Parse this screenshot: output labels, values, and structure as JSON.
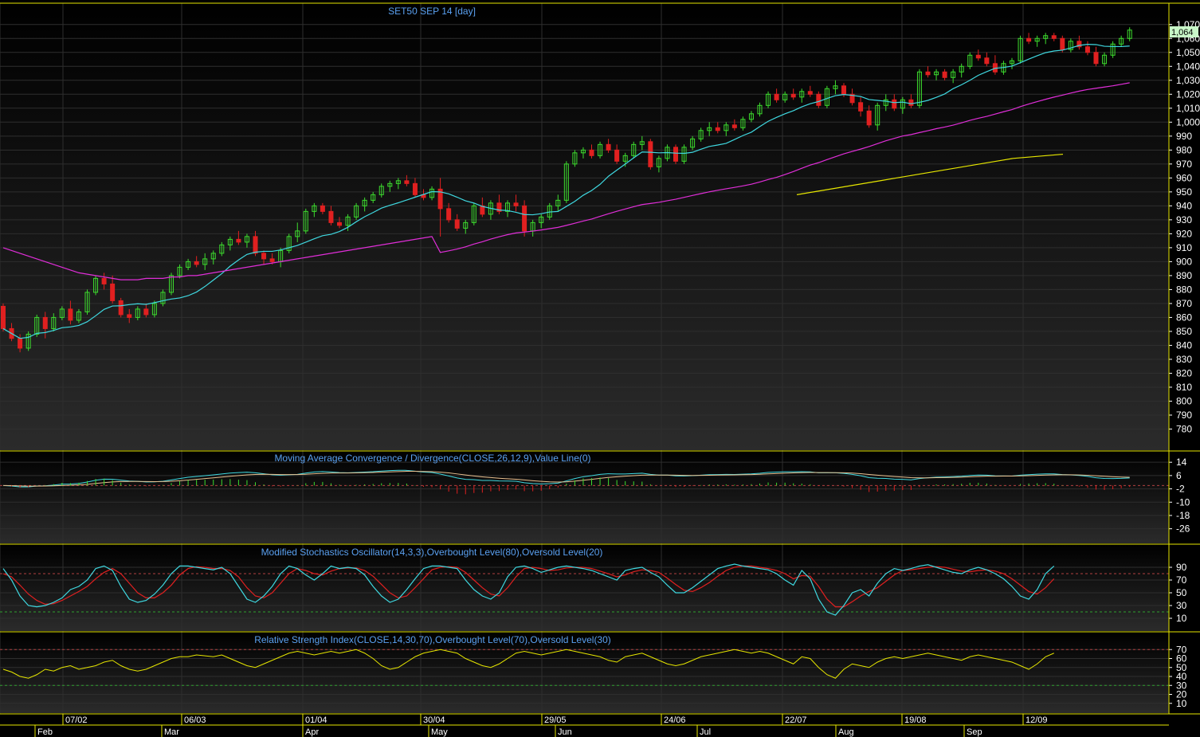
{
  "chart_data": [
    {
      "type": "candlestick",
      "title": "SET50 SEP 14   [day]",
      "last_value_label": "1,064",
      "ylim": [
        770,
        1075
      ],
      "y_ticks": [
        "1,070",
        "1,060",
        "1,050",
        "1,040",
        "1,030",
        "1,020",
        "1,010",
        "1,000",
        "990",
        "980",
        "970",
        "960",
        "950",
        "940",
        "930",
        "920",
        "910",
        "900",
        "890",
        "880",
        "870",
        "860",
        "850",
        "840",
        "830",
        "820",
        "810",
        "800",
        "790",
        "780"
      ],
      "candles": [
        [
          868,
          870,
          850,
          852
        ],
        [
          852,
          856,
          843,
          845
        ],
        [
          845,
          848,
          835,
          838
        ],
        [
          838,
          850,
          836,
          848
        ],
        [
          848,
          862,
          846,
          860
        ],
        [
          860,
          864,
          845,
          852
        ],
        [
          852,
          863,
          850,
          860
        ],
        [
          860,
          868,
          858,
          866
        ],
        [
          866,
          872,
          855,
          858
        ],
        [
          858,
          866,
          856,
          864
        ],
        [
          864,
          880,
          862,
          878
        ],
        [
          878,
          890,
          876,
          888
        ],
        [
          888,
          892,
          880,
          884
        ],
        [
          884,
          890,
          870,
          872
        ],
        [
          872,
          874,
          860,
          862
        ],
        [
          862,
          866,
          856,
          860
        ],
        [
          860,
          868,
          858,
          866
        ],
        [
          866,
          870,
          860,
          862
        ],
        [
          862,
          872,
          860,
          870
        ],
        [
          870,
          880,
          868,
          878
        ],
        [
          878,
          892,
          876,
          890
        ],
        [
          890,
          898,
          888,
          896
        ],
        [
          896,
          902,
          894,
          900
        ],
        [
          900,
          904,
          896,
          898
        ],
        [
          898,
          906,
          894,
          902
        ],
        [
          902,
          908,
          898,
          906
        ],
        [
          906,
          914,
          904,
          912
        ],
        [
          912,
          918,
          908,
          916
        ],
        [
          916,
          922,
          912,
          914
        ],
        [
          914,
          920,
          910,
          918
        ],
        [
          918,
          922,
          904,
          906
        ],
        [
          906,
          908,
          898,
          902
        ],
        [
          902,
          906,
          898,
          900
        ],
        [
          900,
          910,
          896,
          908
        ],
        [
          908,
          920,
          906,
          918
        ],
        [
          918,
          928,
          914,
          922
        ],
        [
          922,
          938,
          920,
          936
        ],
        [
          936,
          942,
          932,
          940
        ],
        [
          940,
          942,
          934,
          936
        ],
        [
          936,
          940,
          926,
          928
        ],
        [
          928,
          932,
          924,
          926
        ],
        [
          926,
          934,
          922,
          932
        ],
        [
          932,
          942,
          930,
          940
        ],
        [
          940,
          946,
          936,
          944
        ],
        [
          944,
          950,
          942,
          948
        ],
        [
          948,
          956,
          946,
          954
        ],
        [
          954,
          958,
          950,
          956
        ],
        [
          956,
          960,
          952,
          958
        ],
        [
          958,
          962,
          954,
          956
        ],
        [
          956,
          960,
          946,
          948
        ],
        [
          948,
          952,
          944,
          946
        ],
        [
          946,
          954,
          944,
          952
        ],
        [
          952,
          960,
          918,
          938
        ],
        [
          938,
          942,
          928,
          930
        ],
        [
          930,
          934,
          922,
          924
        ],
        [
          924,
          930,
          920,
          928
        ],
        [
          928,
          942,
          926,
          940
        ],
        [
          940,
          946,
          932,
          934
        ],
        [
          934,
          944,
          930,
          942
        ],
        [
          942,
          948,
          934,
          936
        ],
        [
          936,
          944,
          932,
          942
        ],
        [
          942,
          948,
          936,
          940
        ],
        [
          940,
          944,
          918,
          922
        ],
        [
          922,
          930,
          918,
          928
        ],
        [
          928,
          934,
          924,
          932
        ],
        [
          932,
          942,
          930,
          940
        ],
        [
          940,
          948,
          936,
          944
        ],
        [
          944,
          972,
          942,
          970
        ],
        [
          970,
          980,
          968,
          978
        ],
        [
          978,
          982,
          974,
          980
        ],
        [
          980,
          984,
          974,
          976
        ],
        [
          976,
          986,
          974,
          984
        ],
        [
          984,
          988,
          978,
          980
        ],
        [
          980,
          984,
          970,
          972
        ],
        [
          972,
          978,
          968,
          976
        ],
        [
          976,
          986,
          974,
          984
        ],
        [
          984,
          990,
          980,
          986
        ],
        [
          986,
          988,
          966,
          968
        ],
        [
          968,
          976,
          964,
          974
        ],
        [
          974,
          984,
          972,
          982
        ],
        [
          982,
          984,
          970,
          972
        ],
        [
          972,
          984,
          970,
          982
        ],
        [
          982,
          990,
          980,
          988
        ],
        [
          988,
          996,
          986,
          994
        ],
        [
          994,
          1000,
          990,
          996
        ],
        [
          996,
          1000,
          992,
          994
        ],
        [
          994,
          1000,
          990,
          998
        ],
        [
          998,
          1002,
          994,
          996
        ],
        [
          996,
          1004,
          994,
          1002
        ],
        [
          1002,
          1008,
          1000,
          1006
        ],
        [
          1006,
          1014,
          1004,
          1012
        ],
        [
          1012,
          1022,
          1010,
          1020
        ],
        [
          1020,
          1024,
          1014,
          1016
        ],
        [
          1016,
          1022,
          1014,
          1020
        ],
        [
          1020,
          1024,
          1016,
          1018
        ],
        [
          1018,
          1024,
          1014,
          1022
        ],
        [
          1022,
          1026,
          1018,
          1020
        ],
        [
          1020,
          1022,
          1010,
          1012
        ],
        [
          1012,
          1026,
          1010,
          1024
        ],
        [
          1024,
          1030,
          1020,
          1026
        ],
        [
          1026,
          1028,
          1018,
          1020
        ],
        [
          1020,
          1024,
          1012,
          1014
        ],
        [
          1014,
          1018,
          1004,
          1008
        ],
        [
          1008,
          1012,
          996,
          998
        ],
        [
          998,
          1014,
          994,
          1012
        ],
        [
          1012,
          1020,
          1008,
          1016
        ],
        [
          1016,
          1020,
          1008,
          1010
        ],
        [
          1010,
          1018,
          1006,
          1016
        ],
        [
          1016,
          1020,
          1010,
          1012
        ],
        [
          1012,
          1038,
          1010,
          1036
        ],
        [
          1036,
          1040,
          1032,
          1034
        ],
        [
          1034,
          1038,
          1030,
          1036
        ],
        [
          1036,
          1038,
          1030,
          1032
        ],
        [
          1032,
          1038,
          1028,
          1036
        ],
        [
          1036,
          1042,
          1032,
          1040
        ],
        [
          1040,
          1050,
          1038,
          1048
        ],
        [
          1048,
          1052,
          1044,
          1046
        ],
        [
          1046,
          1050,
          1040,
          1042
        ],
        [
          1042,
          1048,
          1034,
          1036
        ],
        [
          1036,
          1044,
          1034,
          1042
        ],
        [
          1042,
          1046,
          1038,
          1044
        ],
        [
          1044,
          1062,
          1042,
          1060
        ],
        [
          1060,
          1064,
          1056,
          1058
        ],
        [
          1058,
          1062,
          1054,
          1060
        ],
        [
          1060,
          1064,
          1056,
          1062
        ],
        [
          1062,
          1064,
          1058,
          1060
        ],
        [
          1060,
          1062,
          1050,
          1052
        ],
        [
          1052,
          1060,
          1050,
          1058
        ],
        [
          1058,
          1062,
          1052,
          1054
        ],
        [
          1054,
          1058,
          1048,
          1050
        ],
        [
          1050,
          1054,
          1040,
          1042
        ],
        [
          1042,
          1050,
          1040,
          1048
        ],
        [
          1048,
          1058,
          1046,
          1056
        ],
        [
          1056,
          1062,
          1054,
          1060
        ],
        [
          1060,
          1068,
          1058,
          1066
        ]
      ],
      "moving_averages": [
        {
          "name": "short",
          "color": "#3fd8e0",
          "period": 10
        },
        {
          "name": "medium",
          "color": "#e02ed8",
          "period": 50
        },
        {
          "name": "long",
          "color": "#e6e600",
          "period": 200
        }
      ],
      "long_ma_values": [
        948,
        950,
        952,
        954,
        956,
        958,
        960,
        962,
        964,
        966,
        968,
        970,
        972,
        974,
        975,
        976,
        977
      ],
      "medium_ma_start": [
        910,
        908,
        906,
        904,
        902,
        900,
        898,
        896,
        894,
        892,
        891,
        890,
        889,
        888,
        887,
        887,
        887,
        888,
        888,
        888,
        889,
        889,
        890,
        890,
        891,
        892,
        893,
        894,
        895,
        896,
        897,
        898,
        899,
        900,
        901,
        902,
        903,
        904,
        905,
        906,
        907,
        908,
        909,
        910,
        911,
        912,
        913,
        914,
        915,
        916,
        917,
        918
      ]
    },
    {
      "type": "line",
      "title": "Moving Average Convergence / Divergence(CLOSE,26,12,9),Value Line(0)",
      "ylim": [
        -30,
        16
      ],
      "y_ticks": [
        "14",
        "6",
        "-2",
        "-10",
        "-18",
        "-26"
      ],
      "zero_line": 0
    },
    {
      "type": "line",
      "title": "Modified Stochastics Oscillator(14,3,3),Overbought Level(80),Oversold Level(20)",
      "ylim": [
        0,
        100
      ],
      "y_ticks": [
        "90",
        "70",
        "50",
        "30",
        "10"
      ],
      "overbought": 80,
      "oversold": 20,
      "k_values": [
        88,
        70,
        45,
        30,
        28,
        30,
        35,
        42,
        55,
        60,
        70,
        88,
        92,
        85,
        60,
        40,
        35,
        38,
        48,
        62,
        80,
        92,
        92,
        90,
        88,
        86,
        90,
        80,
        60,
        40,
        35,
        45,
        60,
        80,
        92,
        88,
        78,
        70,
        80,
        92,
        88,
        90,
        88,
        78,
        60,
        45,
        35,
        40,
        55,
        72,
        88,
        92,
        92,
        90,
        88,
        70,
        55,
        45,
        40,
        50,
        75,
        90,
        92,
        88,
        82,
        86,
        90,
        92,
        90,
        88,
        85,
        80,
        75,
        70,
        85,
        88,
        90,
        82,
        75,
        62,
        50,
        50,
        58,
        68,
        78,
        88,
        92,
        95,
        92,
        90,
        88,
        86,
        80,
        70,
        62,
        85,
        72,
        40,
        20,
        15,
        30,
        50,
        55,
        45,
        65,
        80,
        88,
        85,
        88,
        92,
        94,
        90,
        86,
        82,
        80,
        86,
        90,
        86,
        80,
        72,
        60,
        45,
        40,
        55,
        80,
        92
      ],
      "d_values": [
        80,
        75,
        62,
        48,
        38,
        32,
        33,
        38,
        45,
        52,
        60,
        72,
        82,
        88,
        80,
        65,
        50,
        42,
        42,
        50,
        62,
        78,
        88,
        91,
        90,
        88,
        88,
        85,
        75,
        58,
        45,
        42,
        50,
        65,
        80,
        88,
        85,
        80,
        78,
        84,
        88,
        89,
        89,
        85,
        76,
        63,
        50,
        42,
        45,
        58,
        72,
        86,
        90,
        91,
        90,
        82,
        70,
        58,
        48,
        45,
        58,
        75,
        88,
        90,
        88,
        85,
        86,
        89,
        90,
        90,
        88,
        84,
        80,
        75,
        78,
        83,
        86,
        85,
        82,
        73,
        63,
        54,
        52,
        58,
        66,
        76,
        85,
        90,
        92,
        92,
        90,
        88,
        85,
        80,
        72,
        77,
        76,
        60,
        40,
        28,
        28,
        36,
        45,
        52,
        58,
        68,
        78,
        85,
        86,
        88,
        90,
        91,
        90,
        87,
        84,
        83,
        85,
        86,
        84,
        80,
        72,
        62,
        52,
        48,
        58,
        72
      ]
    },
    {
      "type": "line",
      "title": "Relative Strength Index(CLOSE,14,30,70),Overbought Level(70),Oversold Level(30)",
      "ylim": [
        0,
        80
      ],
      "y_ticks": [
        "70",
        "60",
        "50",
        "40",
        "30",
        "20",
        "10"
      ],
      "overbought": 70,
      "oversold": 30,
      "values": [
        48,
        45,
        40,
        38,
        42,
        48,
        46,
        50,
        52,
        48,
        50,
        52,
        56,
        58,
        52,
        48,
        46,
        48,
        52,
        56,
        60,
        62,
        62,
        64,
        63,
        62,
        64,
        60,
        56,
        52,
        50,
        54,
        58,
        62,
        66,
        68,
        66,
        64,
        66,
        68,
        66,
        68,
        70,
        66,
        60,
        52,
        48,
        50,
        56,
        62,
        66,
        68,
        70,
        68,
        66,
        60,
        56,
        52,
        50,
        54,
        60,
        66,
        68,
        66,
        64,
        66,
        68,
        70,
        68,
        66,
        64,
        62,
        58,
        56,
        62,
        64,
        66,
        62,
        58,
        54,
        52,
        54,
        58,
        62,
        64,
        66,
        68,
        70,
        68,
        66,
        68,
        66,
        62,
        58,
        54,
        62,
        60,
        50,
        42,
        38,
        48,
        54,
        52,
        50,
        56,
        60,
        62,
        60,
        62,
        64,
        66,
        64,
        62,
        60,
        58,
        62,
        64,
        62,
        60,
        58,
        56,
        52,
        48,
        54,
        62,
        66
      ]
    }
  ],
  "x_axis": {
    "date_labels": [
      "07/02",
      "06/03",
      "01/04",
      "30/04",
      "29/05",
      "24/06",
      "22/07",
      "19/08",
      "12/09"
    ],
    "month_labels": [
      "Feb",
      "Mar",
      "Apr",
      "May",
      "Jun",
      "Jul",
      "Aug",
      "Sep"
    ]
  },
  "colors": {
    "background": "#000000",
    "grid": "#2e2e2e",
    "frame": "#e6e600",
    "title": "#5aa0f0",
    "up_candle": "#3ddc2e",
    "down_candle": "#e02020",
    "axis_text": "#ffffff",
    "last_value_bg": "#c8f7c8",
    "macd_line": "#3fd8e0",
    "macd_signal": "#e8c090",
    "stoch_k": "#3fd8e0",
    "stoch_d": "#e02020",
    "rsi_line": "#e6e600",
    "overbought_line": "#b04040",
    "oversold_line": "#2e9e2e"
  }
}
